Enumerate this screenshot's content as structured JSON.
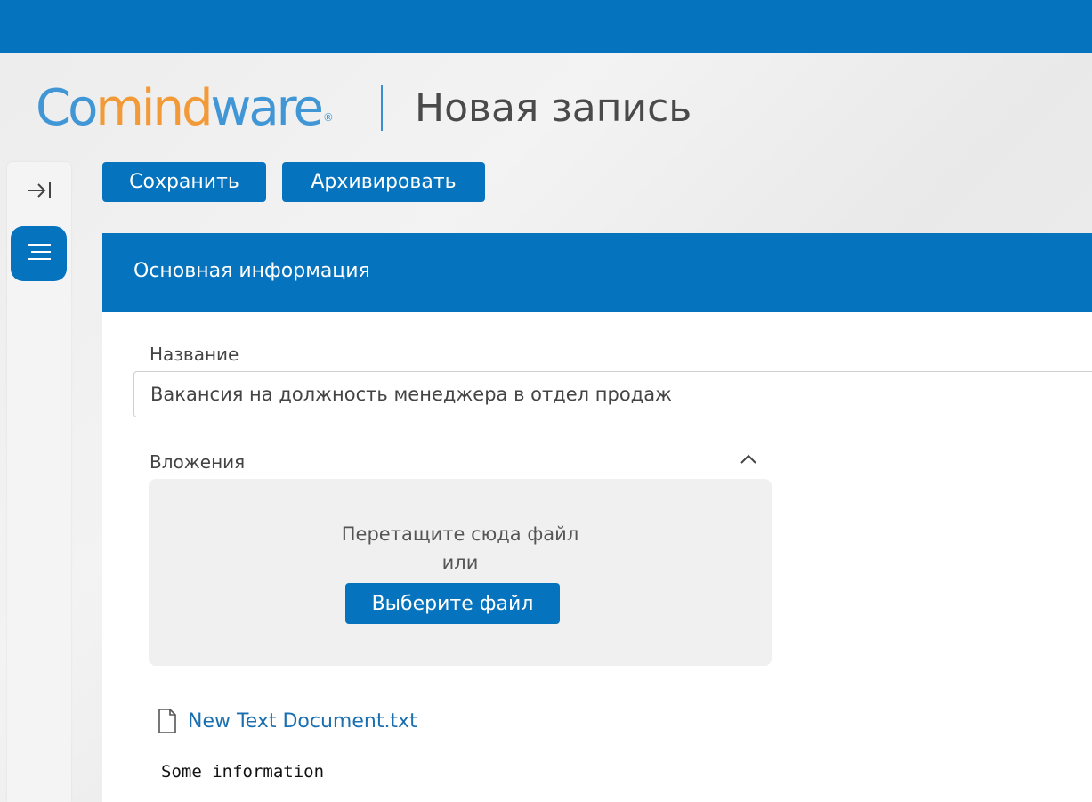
{
  "header": {
    "logo": {
      "part1": "Co",
      "part2": "mind",
      "part3": "ware",
      "reg": "®"
    },
    "title": "Новая запись"
  },
  "toolbar": {
    "save_label": "Сохранить",
    "archive_label": "Архивировать"
  },
  "section": {
    "title": "Основная информация"
  },
  "form": {
    "name_label": "Название",
    "name_value": "Вакансия на должность менеджера в отдел продаж",
    "attachments_label": "Вложения",
    "dropzone_text": "Перетащите сюда файл",
    "dropzone_or": "или",
    "choose_file_label": "Выберите файл",
    "file_name": "New Text Document.txt",
    "file_content": "Some information"
  },
  "icons": {
    "collapse": "collapse-sidebar-icon",
    "menu": "menu-icon",
    "chevron": "chevron-up-icon",
    "file": "file-icon"
  },
  "colors": {
    "primary": "#0573bd",
    "logo_blue": "#4196d6",
    "logo_orange": "#f29a38",
    "link": "#1a6fb0"
  }
}
